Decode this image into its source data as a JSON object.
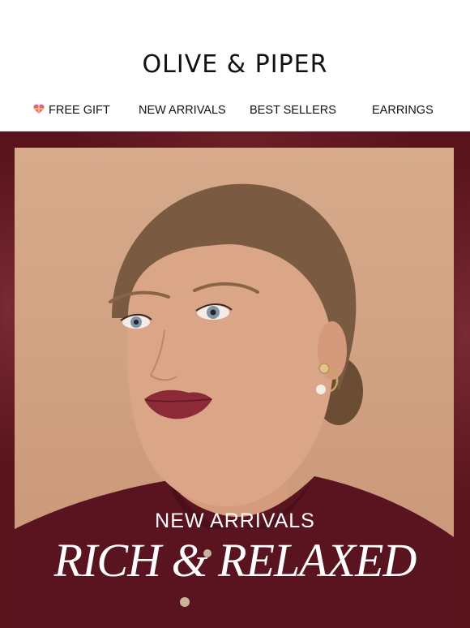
{
  "brand": {
    "logo_text": "OLIVE & PIPER"
  },
  "nav": {
    "items": [
      {
        "label": "FREE GIFT",
        "icon": "heart-gift-icon"
      },
      {
        "label": "NEW ARRIVALS"
      },
      {
        "label": "BEST SELLERS"
      },
      {
        "label": "EARRINGS"
      }
    ]
  },
  "hero": {
    "eyebrow": "NEW ARRIVALS",
    "headline": "RICH & RELAXED",
    "image_alt": "Model wearing gold hoop earrings with pearl drop and burgundy cardigan",
    "colors": {
      "frame": "#5e1620",
      "backdrop": "#d7aa8c",
      "cardigan": "#5a1420",
      "text": "#ffffff"
    }
  }
}
